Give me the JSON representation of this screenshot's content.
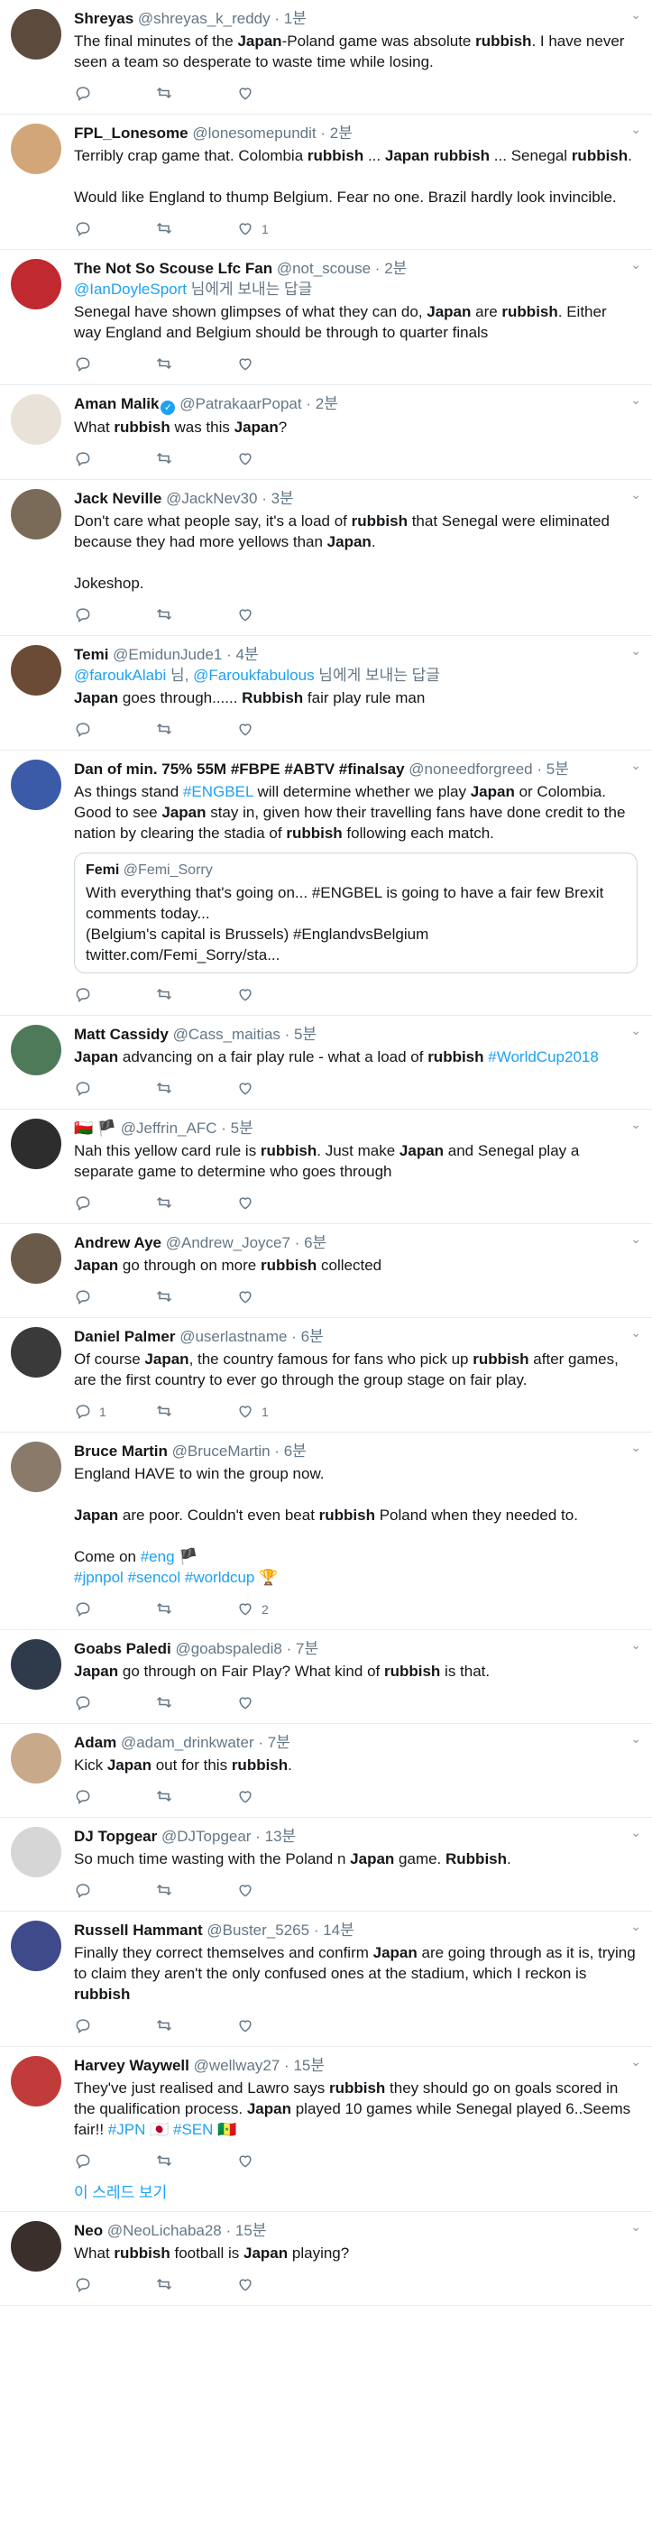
{
  "tweets": [
    {
      "name": "Shreyas",
      "handle": "@shreyas_k_reddy",
      "time": "1분",
      "avatar_color": "#5c4a3d",
      "text": [
        [
          "The final minutes of the ",
          0
        ],
        [
          "Japan",
          1
        ],
        [
          "-Poland game was absolute ",
          0
        ],
        [
          "rubbish",
          1
        ],
        [
          ". I have never seen a team so desperate to waste time while losing.",
          0
        ]
      ],
      "reply_count": "",
      "like_count": ""
    },
    {
      "name": "FPL_Lonesome",
      "handle": "@lonesomepundit",
      "time": "2분",
      "avatar_color": "#d2a679",
      "text": [
        [
          "Terribly crap game that. Colombia ",
          0
        ],
        [
          "rubbish",
          1
        ],
        [
          " ... ",
          0
        ],
        [
          "Japan",
          1
        ],
        [
          " ",
          0
        ],
        [
          "rubbish",
          1
        ],
        [
          " ... Senegal ",
          0
        ],
        [
          "rubbish",
          1
        ],
        [
          ".\n\nWould like England to thump Belgium. Fear no one. Brazil hardly look invincible.",
          0
        ]
      ],
      "reply_count": "",
      "like_count": "1"
    },
    {
      "name": "The Not So Scouse Lfc Fan",
      "handle": "@not_scouse",
      "time": "2분",
      "avatar_color": "#c0292f",
      "reply_to_handle": "@IanDoyleSport",
      "reply_to_suffix": " 님에게 보내는 답글",
      "text": [
        [
          "Senegal have shown glimpses of what they can do, ",
          0
        ],
        [
          "Japan",
          1
        ],
        [
          " are ",
          0
        ],
        [
          "rubbish",
          1
        ],
        [
          ". Either way England and Belgium should be through to quarter finals",
          0
        ]
      ],
      "reply_count": "",
      "like_count": ""
    },
    {
      "name": "Aman Malik",
      "handle": "@PatrakaarPopat",
      "time": "2분",
      "verified": true,
      "avatar_color": "#e8e2d8",
      "text": [
        [
          "What ",
          0
        ],
        [
          "rubbish",
          1
        ],
        [
          " was this ",
          0
        ],
        [
          "Japan",
          1
        ],
        [
          "?",
          0
        ]
      ],
      "reply_count": "",
      "like_count": ""
    },
    {
      "name": "Jack Neville",
      "handle": "@JackNev30",
      "time": "3분",
      "avatar_color": "#7a6a58",
      "text": [
        [
          "Don't care what people say, it's a load of ",
          0
        ],
        [
          "rubbish",
          1
        ],
        [
          " that Senegal were eliminated because they had more yellows than ",
          0
        ],
        [
          "Japan",
          1
        ],
        [
          ".\n\nJokeshop.",
          0
        ]
      ],
      "reply_count": "",
      "like_count": ""
    },
    {
      "name": "Temi",
      "handle": "@EmidunJude1",
      "time": "4분",
      "avatar_color": "#6b4a36",
      "reply_to_handle": "@faroukAlabi",
      "reply_to_mid": " 님, ",
      "reply_to_handle2": "@Faroukfabulous",
      "reply_to_suffix": " 님에게 보내는 답글",
      "text": [
        [
          "Japan",
          1
        ],
        [
          " goes through...... ",
          0
        ],
        [
          "Rubbish",
          1
        ],
        [
          " fair play rule man",
          0
        ]
      ],
      "reply_count": "",
      "like_count": ""
    },
    {
      "name": "Dan of min. 75% 55M #FBPE #ABTV #finalsay",
      "handle": "@noneedforgreed",
      "time": "5분",
      "avatar_color": "#3b5ba8",
      "text": [
        [
          "As things stand ",
          0
        ],
        [
          "#ENGBEL",
          2
        ],
        [
          " will determine whether we play ",
          0
        ],
        [
          "Japan",
          1
        ],
        [
          " or Colombia. Good to see ",
          0
        ],
        [
          "Japan",
          1
        ],
        [
          " stay in, given how their travelling fans have done credit to the nation by clearing the stadia of ",
          0
        ],
        [
          "rubbish",
          1
        ],
        [
          " following each match.",
          0
        ]
      ],
      "quote": {
        "name": "Femi",
        "handle": "@Femi_Sorry",
        "text": "With everything that's going on... #ENGBEL is going to have a fair few Brexit comments today...\n(Belgium's capital is Brussels) #EnglandvsBelgium\ntwitter.com/Femi_Sorry/sta..."
      },
      "reply_count": "",
      "like_count": ""
    },
    {
      "name": "Matt Cassidy",
      "handle": "@Cass_maitias",
      "time": "5분",
      "avatar_color": "#4f7a5a",
      "text": [
        [
          "Japan",
          1
        ],
        [
          " advancing on a fair play rule - what a load of ",
          0
        ],
        [
          "rubbish",
          1
        ],
        [
          " ",
          0
        ],
        [
          "#WorldCup2018",
          2
        ]
      ],
      "reply_count": "",
      "like_count": ""
    },
    {
      "name": "🇴🇲 🏴",
      "handle": "@Jeffrin_AFC",
      "time": "5분",
      "avatar_color": "#2d2d2d",
      "text": [
        [
          "Nah this yellow card rule is ",
          0
        ],
        [
          "rubbish",
          1
        ],
        [
          ". Just make ",
          0
        ],
        [
          "Japan",
          1
        ],
        [
          " and Senegal play a separate game to determine who goes through",
          0
        ]
      ],
      "reply_count": "",
      "like_count": ""
    },
    {
      "name": "Andrew Aye",
      "handle": "@Andrew_Joyce7",
      "time": "6분",
      "avatar_color": "#6a5a4a",
      "text": [
        [
          "Japan",
          1
        ],
        [
          " go through on more ",
          0
        ],
        [
          "rubbish",
          1
        ],
        [
          " collected",
          0
        ]
      ],
      "reply_count": "",
      "like_count": ""
    },
    {
      "name": "Daniel Palmer",
      "handle": "@userlastname",
      "time": "6분",
      "avatar_color": "#3a3a3a",
      "text": [
        [
          "Of course ",
          0
        ],
        [
          "Japan",
          1
        ],
        [
          ", the country famous for fans who pick up ",
          0
        ],
        [
          "rubbish",
          1
        ],
        [
          " after games, are the first country to ever go through the group stage on fair play.",
          0
        ]
      ],
      "reply_count": "1",
      "like_count": "1"
    },
    {
      "name": "Bruce Martin",
      "handle": "@BruceMartin",
      "time": "6분",
      "avatar_color": "#8a7a6a",
      "text": [
        [
          "England HAVE to win the group now.\n\n",
          0
        ],
        [
          "Japan",
          1
        ],
        [
          " are poor. Couldn't even beat ",
          0
        ],
        [
          "rubbish",
          1
        ],
        [
          " Poland when they needed to.\n\nCome on ",
          0
        ],
        [
          "#eng",
          2
        ],
        [
          " 🏴\n",
          0
        ],
        [
          "#jpnpol #sencol #worldcup",
          2
        ],
        [
          " 🏆",
          0
        ]
      ],
      "reply_count": "",
      "like_count": "2"
    },
    {
      "name": "Goabs Paledi",
      "handle": "@goabspaledi8",
      "time": "7분",
      "avatar_color": "#2f3a4a",
      "text": [
        [
          "Japan",
          1
        ],
        [
          " go through on Fair Play? What kind of ",
          0
        ],
        [
          "rubbish",
          1
        ],
        [
          " is that.",
          0
        ]
      ],
      "reply_count": "",
      "like_count": ""
    },
    {
      "name": "Adam",
      "handle": "@adam_drinkwater",
      "time": "7분",
      "avatar_color": "#c8a98a",
      "text": [
        [
          "Kick ",
          0
        ],
        [
          "Japan",
          1
        ],
        [
          " out for this ",
          0
        ],
        [
          "rubbish",
          1
        ],
        [
          ".",
          0
        ]
      ],
      "reply_count": "",
      "like_count": ""
    },
    {
      "name": "DJ Topgear",
      "handle": "@DJTopgear",
      "time": "13분",
      "avatar_color": "#d6d6d6",
      "text": [
        [
          "So much time wasting with the Poland n ",
          0
        ],
        [
          "Japan",
          1
        ],
        [
          " game. ",
          0
        ],
        [
          "Rubbish",
          1
        ],
        [
          ".",
          0
        ]
      ],
      "reply_count": "",
      "like_count": ""
    },
    {
      "name": "Russell Hammant",
      "handle": "@Buster_5265",
      "time": "14분",
      "avatar_color": "#3e4a8a",
      "text": [
        [
          "Finally they correct themselves and confirm ",
          0
        ],
        [
          "Japan",
          1
        ],
        [
          " are going through as it is, trying to claim they aren't the only confused ones at the stadium, which I reckon is ",
          0
        ],
        [
          "rubbish",
          1
        ]
      ],
      "reply_count": "",
      "like_count": ""
    },
    {
      "name": "Harvey Waywell",
      "handle": "@wellway27",
      "time": "15분",
      "avatar_color": "#c23b3b",
      "text": [
        [
          "They've just realised and Lawro says ",
          0
        ],
        [
          "rubbish",
          1
        ],
        [
          " they should go on goals scored in the qualification process. ",
          0
        ],
        [
          "Japan",
          1
        ],
        [
          " played 10 games while Senegal played 6..Seems fair!! ",
          0
        ],
        [
          "#JPN",
          2
        ],
        [
          " 🇯🇵 ",
          0
        ],
        [
          "#SEN",
          2
        ],
        [
          " 🇸🇳",
          0
        ]
      ],
      "reply_count": "",
      "like_count": "",
      "thread_label": "이 스레드 보기"
    },
    {
      "name": "Neo",
      "handle": "@NeoLichaba28",
      "time": "15분",
      "avatar_color": "#3a2f2a",
      "text": [
        [
          "What ",
          0
        ],
        [
          "rubbish",
          1
        ],
        [
          " football is ",
          0
        ],
        [
          "Japan",
          1
        ],
        [
          " playing?",
          0
        ]
      ],
      "reply_count": "",
      "like_count": ""
    }
  ],
  "separator": "·",
  "caret": "⌄"
}
